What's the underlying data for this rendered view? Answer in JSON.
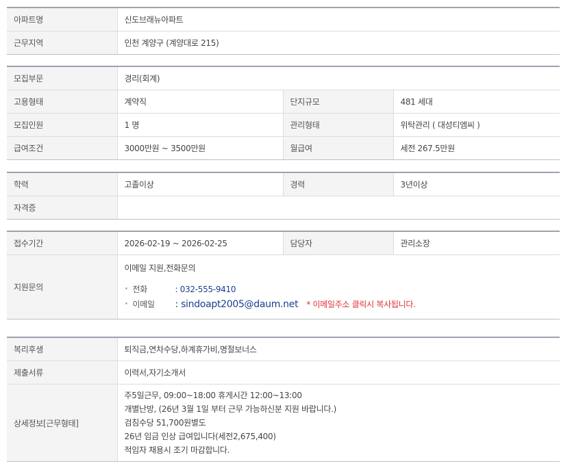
{
  "section1": {
    "apt_name_label": "아파트명",
    "apt_name_value": "신도브래뉴아파트",
    "region_label": "근무지역",
    "region_value": "인천  계양구 (계양대로 215)"
  },
  "section2": {
    "dept_label": "모집부문",
    "dept_value": "경리(회계)",
    "employ_label": "고용형태",
    "employ_value": "계약직",
    "scale_label": "단지규모",
    "scale_value": "481 세대",
    "count_label": "모집인원",
    "count_value": "1 명",
    "manage_label": "관리형태",
    "manage_value": "위탁관리 ( 대성티엠씨 )",
    "salary_label": "급여조건",
    "salary_value": "3000만원 ~ 3500만원",
    "monthly_label": "월급여",
    "monthly_value": "세전 267.5만원"
  },
  "section3": {
    "edu_label": "학력",
    "edu_value": "고졸이상",
    "career_label": "경력",
    "career_value": "3년이상",
    "cert_label": "자격증",
    "cert_value": ""
  },
  "section4": {
    "period_label": "접수기간",
    "period_value": "2026-02-19 ~ 2026-02-25",
    "manager_label": "담당자",
    "manager_value": "관리소장",
    "inquiry_label": "지원문의",
    "inquiry_value": "이메일 지원,전화문의",
    "bullet": "•",
    "phone_key": "전화",
    "phone_value": ": 032-555-9410",
    "email_key": "이메일",
    "email_value": ": sindoapt2005@daum.net",
    "email_notice": "* 이메일주소 클릭시 복사됩니다."
  },
  "section5": {
    "welfare_label": "복리후생",
    "welfare_value": "퇴직금,연차수당,하계휴가비,명절보너스",
    "docs_label": "제출서류",
    "docs_value": "이력서,자기소개서",
    "detail_label": "상세정보[근무형태]",
    "detail_lines": [
      "주5일근무, 09:00~18:00 휴게시간 12:00~13:00",
      "개별난방, (26년 3월 1일 부터 근무 가능하신분 지원 바랍니다.)",
      "검침수당 51,700원별도",
      "26년 임금 인상 급여입니다(세전2,675,400)",
      "적임자 채용시 조기 마감합니다."
    ]
  },
  "colors": {
    "label_bg": "#f4f4f4",
    "top_border": "#9aa3ad",
    "link_blue": "#1a3f8f",
    "notice_red": "#e03030"
  }
}
